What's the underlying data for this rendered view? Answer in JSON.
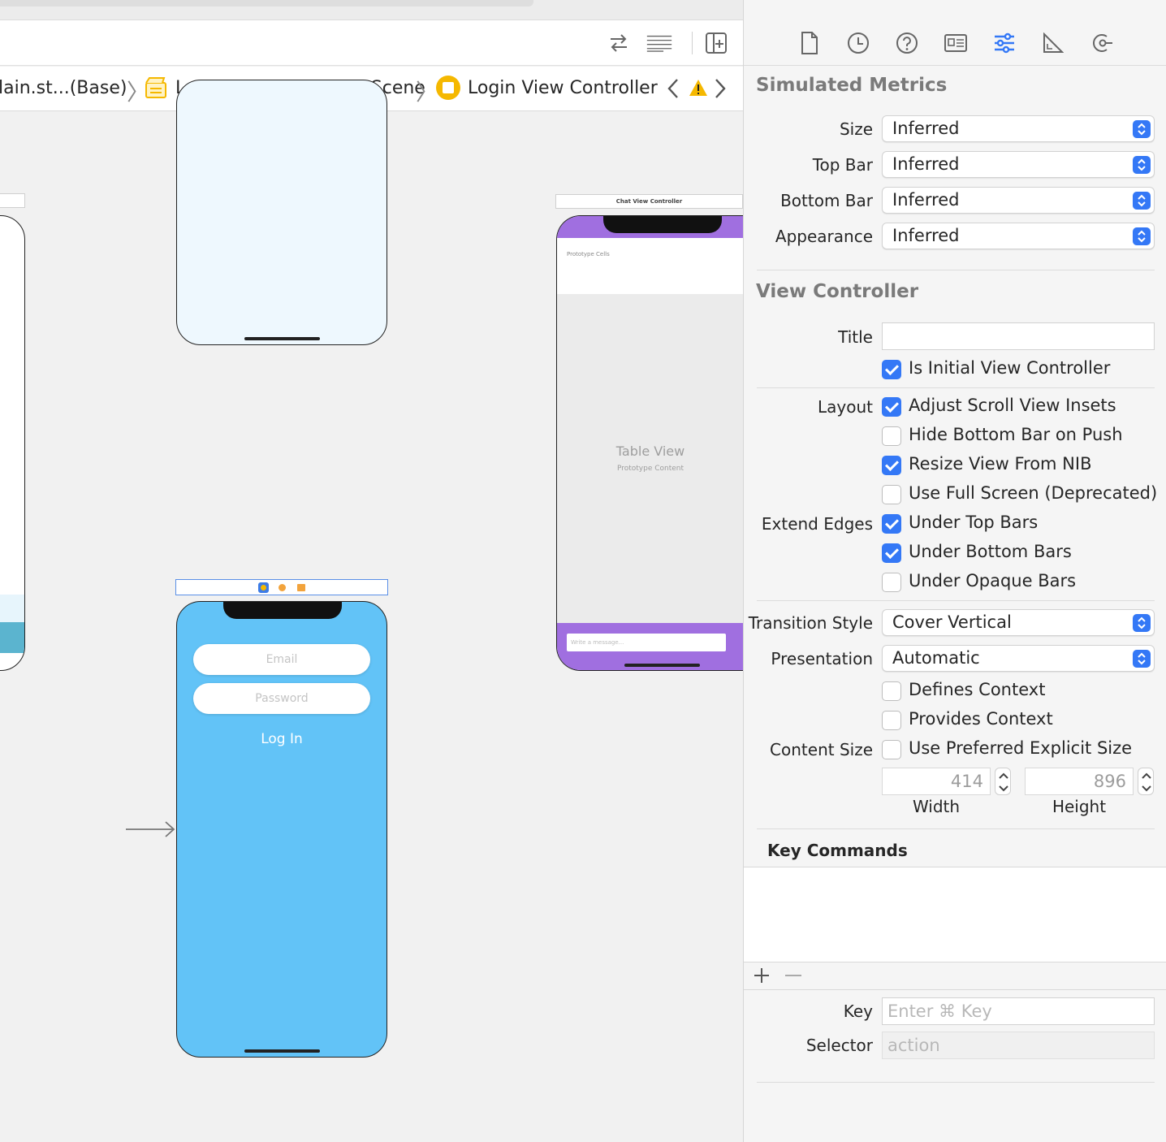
{
  "breadcrumb": {
    "items": [
      "lain.st...(Base)",
      "Login View Controller Scene",
      "Login View Controller"
    ]
  },
  "canvas": {
    "chat_scene_label": "Chat View Controller",
    "chat_prototype_cells": "Prototype Cells",
    "chat_table_view": "Table View",
    "chat_prototype_content": "Prototype Content",
    "chat_message_placeholder": "Write a message...",
    "login_email_placeholder": "Email",
    "login_password_placeholder": "Password",
    "login_button": "Log In"
  },
  "inspector": {
    "simulated_metrics": {
      "title": "Simulated Metrics",
      "size_label": "Size",
      "size_value": "Inferred",
      "top_bar_label": "Top Bar",
      "top_bar_value": "Inferred",
      "bottom_bar_label": "Bottom Bar",
      "bottom_bar_value": "Inferred",
      "appearance_label": "Appearance",
      "appearance_value": "Inferred"
    },
    "view_controller": {
      "title": "View Controller",
      "title_label": "Title",
      "title_value": "",
      "is_initial": "Is Initial View Controller",
      "layout_label": "Layout",
      "adjust_scroll": "Adjust Scroll View Insets",
      "hide_bottom": "Hide Bottom Bar on Push",
      "resize_nib": "Resize View From NIB",
      "full_screen": "Use Full Screen (Deprecated)",
      "extend_label": "Extend Edges",
      "under_top": "Under Top Bars",
      "under_bottom": "Under Bottom Bars",
      "under_opaque": "Under Opaque Bars",
      "transition_label": "Transition Style",
      "transition_value": "Cover Vertical",
      "presentation_label": "Presentation",
      "presentation_value": "Automatic",
      "defines_context": "Defines Context",
      "provides_context": "Provides Context",
      "content_size_label": "Content Size",
      "preferred_size": "Use Preferred Explicit Size",
      "width_value": "414",
      "height_value": "896",
      "width_label": "Width",
      "height_label": "Height"
    },
    "key_commands": {
      "title": "Key Commands",
      "key_label": "Key",
      "key_placeholder": "Enter ⌘ Key",
      "selector_label": "Selector",
      "selector_placeholder": "action"
    }
  },
  "colors": {
    "accent": "#3478f6",
    "login_bg": "#62c3f7",
    "chat_purple": "#a06fe0",
    "warning": "#f5b800"
  }
}
